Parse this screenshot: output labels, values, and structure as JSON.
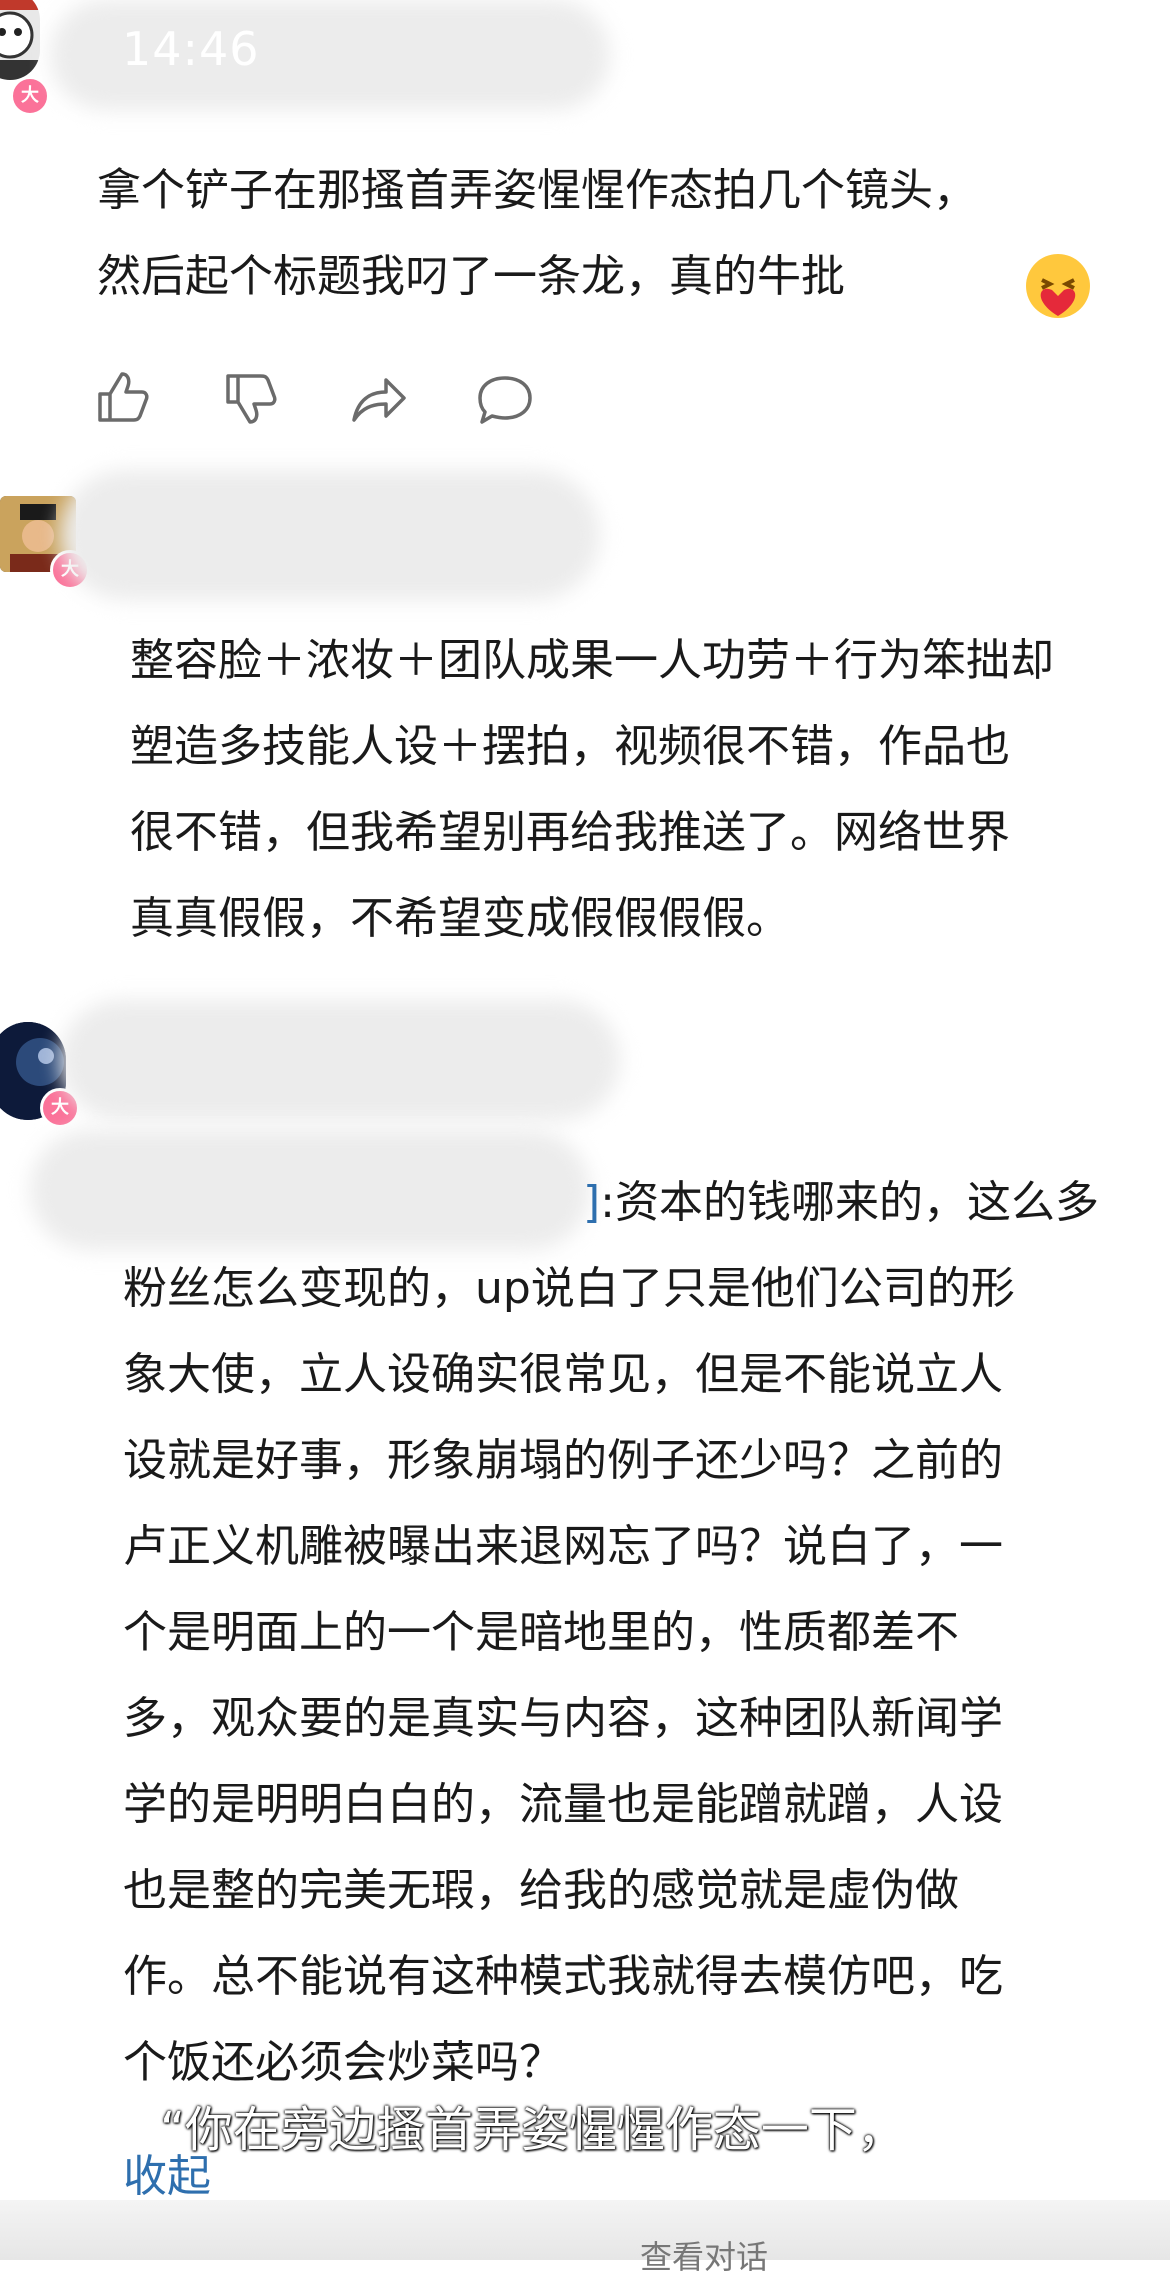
{
  "status_bar": {
    "time": "14:46"
  },
  "comments": [
    {
      "badge": "大",
      "text_lines": [
        "拿个铲子在那搔首弄姿惺惺作态拍几个镜头，",
        "然后起个标题我叼了一条龙，真的牛批"
      ],
      "emoji": "heart-hug-emoji",
      "actions": [
        "like-icon",
        "dislike-icon",
        "share-icon",
        "reply-icon"
      ]
    },
    {
      "badge": "大",
      "text_lines": [
        "整容脸＋浓妆＋团队成果一人功劳＋行为笨拙却",
        "塑造多技能人设＋摆拍，视频很不错，作品也",
        "很不错，但我希望别再给我推送了。网络世界",
        "真真假假，不希望变成假假假假。"
      ]
    },
    {
      "badge": "大",
      "link_tail": "]",
      "text_lines": [
        ":资本的钱哪来的，这么多",
        "粉丝怎么变现的，up说白了只是他们公司的形",
        "象大使，立人设确实很常见，但是不能说立人",
        "设就是好事，形象崩塌的例子还少吗？之前的",
        "卢正义机雕被曝出来退网忘了吗？说白了，一",
        "个是明面上的一个是暗地里的，性质都差不",
        "多，观众要的是真实与内容，这种团队新闻学",
        "学的是明明白白的，流量也是能蹭就蹭，人设",
        "也是整的完美无瑕，给我的感觉就是虚伪做",
        "作。总不能说有这种模式我就得去模仿吧，吃",
        "个饭还必须会炒菜吗？"
      ],
      "collapse_label": "收起"
    }
  ],
  "subtitle": "“你在旁边搔首弄姿惺惺作态一下，",
  "bottom_bar": {
    "dialog_label": "查看对话"
  },
  "colors": {
    "badge": "#fb7299",
    "link": "#2e6fae"
  }
}
